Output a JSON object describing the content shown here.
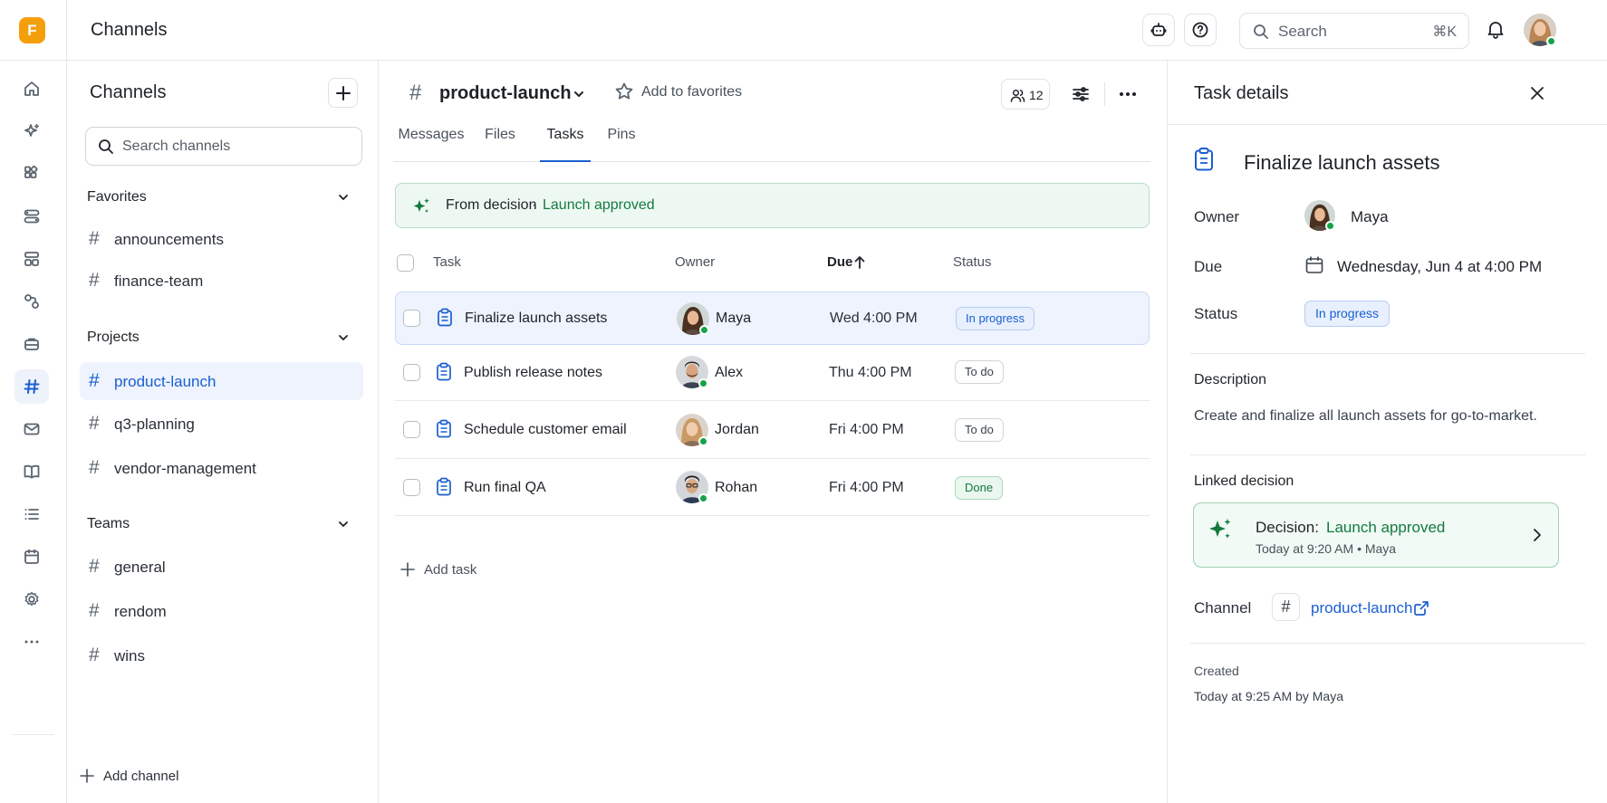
{
  "app": {
    "logo_letter": "F",
    "title": "Channels"
  },
  "topbar": {
    "search_placeholder": "Search",
    "search_shortcut": "⌘K",
    "icons": [
      "bot-icon",
      "help-icon",
      "bell-icon"
    ]
  },
  "rail": {
    "icons": [
      "home-icon",
      "sparkle-icon",
      "apps-icon",
      "toggles-icon",
      "layout-icon",
      "workflow-icon",
      "briefcase-icon",
      "hash-icon",
      "mail-icon",
      "book-icon",
      "list-icon",
      "calendar-icon",
      "settings-icon",
      "more-icon"
    ],
    "active": "hash-icon"
  },
  "sidebar": {
    "title": "Channels",
    "search_placeholder": "Search channels",
    "groups": [
      {
        "label": "Favorites",
        "items": [
          "announcements",
          "finance-team"
        ]
      },
      {
        "label": "Projects",
        "items": [
          "product-launch",
          "q3-planning",
          "vendor-management"
        ]
      },
      {
        "label": "Teams",
        "items": [
          "general",
          "rendom",
          "wins"
        ]
      }
    ],
    "active_channel": "product-launch",
    "add_channel": "Add channel"
  },
  "channel": {
    "hash": "#",
    "name": "product-launch",
    "favorite_label": "Add to favorites",
    "member_count": "12",
    "tabs": [
      "Messages",
      "Files",
      "Tasks",
      "Pins"
    ],
    "active_tab": "Tasks"
  },
  "banner": {
    "label": "From decision",
    "separator": "·",
    "value": "Launch approved"
  },
  "table": {
    "headers": {
      "task": "Task",
      "owner": "Owner",
      "due": "Due",
      "status": "Status"
    },
    "sorted_by": "Due",
    "sort_direction": "ascending",
    "rows": [
      {
        "task": "Finalize launch assets",
        "owner": "Maya",
        "due": "Wed 4:00 PM",
        "status": "In progress",
        "selected": true
      },
      {
        "task": "Publish release notes",
        "owner": "Alex",
        "due": "Thu 4:00 PM",
        "status": "To do",
        "selected": false
      },
      {
        "task": "Schedule customer email",
        "owner": "Jordan",
        "due": "Fri 4:00 PM",
        "status": "To do",
        "selected": false
      },
      {
        "task": "Run final QA",
        "owner": "Rohan",
        "due": "Fri 4:00 PM",
        "status": "Done",
        "selected": false
      }
    ],
    "add_task": "Add task"
  },
  "details": {
    "title": "Task details",
    "task_title": "Finalize launch assets",
    "owner_label": "Owner",
    "owner": "Maya",
    "due_label": "Due",
    "due": "Wednesday, Jun 4 at 4:00 PM",
    "status_label": "Status",
    "status": "In progress",
    "description_label": "Description",
    "description": "Create and finalize all launch assets for go-to-market.",
    "linked_label": "Linked decision",
    "decision_label": "Decision:",
    "decision_value": "Launch approved",
    "decision_meta": "Today at 9:20 AM • Maya",
    "channel_label": "Channel",
    "channel_hash": "#",
    "channel_name": "product-launch",
    "created_label": "Created",
    "created_value": "Today at 9:25 AM by Maya"
  },
  "colors": {
    "accent": "#1a5fd0",
    "brand": "#f59e0b",
    "success": "#137a3f",
    "presence": "#16a34a"
  }
}
